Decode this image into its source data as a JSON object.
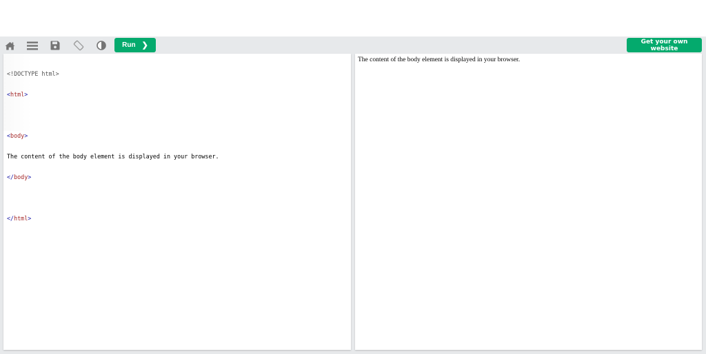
{
  "toolbar": {
    "icons": [
      {
        "name": "home-icon"
      },
      {
        "name": "menu-icon"
      },
      {
        "name": "save-icon"
      },
      {
        "name": "rotate-icon"
      },
      {
        "name": "theme-contrast-icon"
      }
    ],
    "run_label": "Run",
    "run_chevron": "❯",
    "get_website_label": "Get your own website",
    "accent_color": "#04aa6d"
  },
  "editor": {
    "lines": [
      {
        "doctype": "<!DOCTYPE html>"
      },
      {
        "open": "<",
        "tag": "html",
        "close": ">"
      },
      {
        "blank": true
      },
      {
        "open": "<",
        "tag": "body",
        "close": ">"
      },
      {
        "text": "The content of the body element is displayed in your browser."
      },
      {
        "open": "</",
        "tag": "body",
        "close": ">"
      },
      {
        "blank": true
      },
      {
        "open": "</",
        "tag": "html",
        "close": ">"
      }
    ],
    "line_doctype": "<!DOCTYPE html>",
    "line_html_open": "html",
    "line_body_open": "body",
    "line_text": "The content of the body element is displayed in your browser.",
    "line_body_close": "body",
    "line_html_close": "html",
    "lt": "<",
    "lt_slash": "</",
    "gt": ">"
  },
  "result": {
    "text": "The content of the body element is displayed in your browser."
  }
}
